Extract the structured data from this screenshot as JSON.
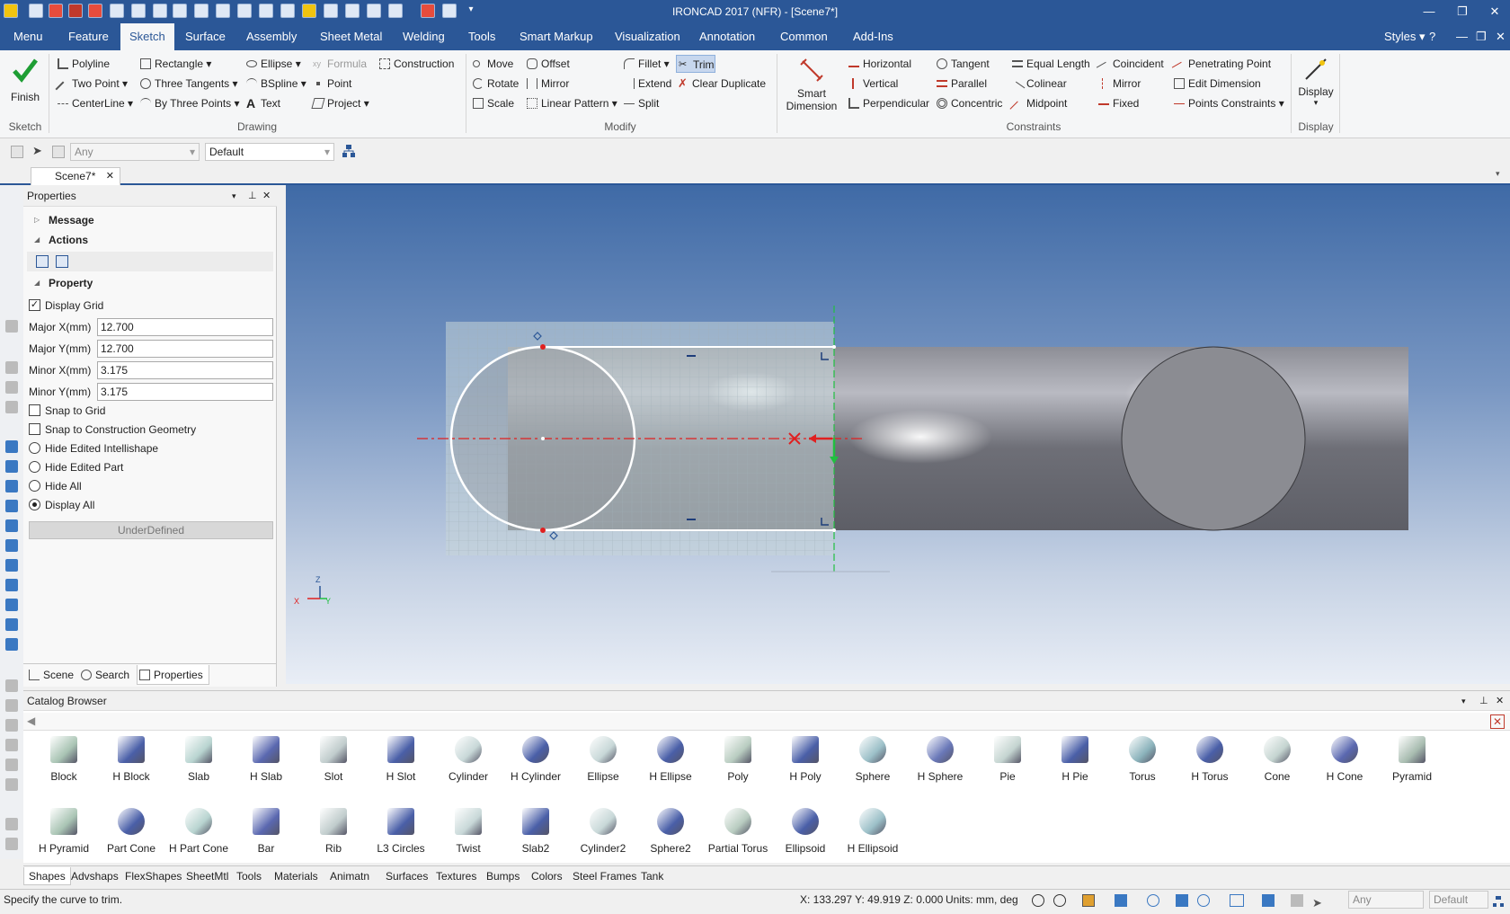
{
  "window": {
    "title": "IRONCAD 2017 (NFR) - [Scene7*]",
    "styles_label": "Styles"
  },
  "menu": [
    "Menu",
    "Feature",
    "Sketch",
    "Surface",
    "Assembly",
    "Sheet Metal",
    "Welding",
    "Tools",
    "Smart Markup",
    "Visualization",
    "Annotation",
    "Common",
    "Add-Ins"
  ],
  "ribbon": {
    "finish": "Finish",
    "groups": {
      "sketch": "Sketch",
      "drawing": "Drawing",
      "modify": "Modify",
      "constraints": "Constraints",
      "display": "Display"
    },
    "drawing": {
      "polyline": "Polyline",
      "rectangle": "Rectangle",
      "ellipse": "Ellipse",
      "formula": "Formula",
      "construction": "Construction",
      "two_point": "Two Point",
      "three_tangents": "Three Tangents",
      "bspline": "BSpline",
      "point": "Point",
      "centerline": "CenterLine",
      "by_three_points": "By Three Points",
      "text": "Text",
      "project": "Project"
    },
    "modify": {
      "move": "Move",
      "offset": "Offset",
      "fillet": "Fillet",
      "trim": "Trim",
      "rotate": "Rotate",
      "mirror": "Mirror",
      "extend": "Extend",
      "clear_duplicate": "Clear Duplicate",
      "scale": "Scale",
      "linear_pattern": "Linear Pattern",
      "split": "Split"
    },
    "smart_dimension_1": "Smart",
    "smart_dimension_2": "Dimension",
    "constraints": {
      "horizontal": "Horizontal",
      "tangent": "Tangent",
      "equal_length": "Equal Length",
      "coincident": "Coincident",
      "penetrating_point": "Penetrating Point",
      "vertical": "Vertical",
      "parallel": "Parallel",
      "colinear": "Colinear",
      "mirror": "Mirror",
      "edit_dimension": "Edit Dimension",
      "perpendicular": "Perpendicular",
      "concentric": "Concentric",
      "midpoint": "Midpoint",
      "fixed": "Fixed",
      "points_constraints": "Points Constraints"
    },
    "display": "Display"
  },
  "filterbar": {
    "filter_value": "Any",
    "style_value": "Default"
  },
  "doc_tab": "Scene7*",
  "properties": {
    "title": "Properties",
    "message": "Message",
    "actions": "Actions",
    "property": "Property",
    "display_grid": "Display Grid",
    "major_x_label": "Major X(mm)",
    "major_x": "12.700",
    "major_y_label": "Major Y(mm)",
    "major_y": "12.700",
    "minor_x_label": "Minor X(mm)",
    "minor_x": "3.175",
    "minor_y_label": "Minor Y(mm)",
    "minor_y": "3.175",
    "snap_grid": "Snap to Grid",
    "snap_construction": "Snap to Construction Geometry",
    "hide_intellishape": "Hide Edited Intellishape",
    "hide_part": "Hide Edited Part",
    "hide_all": "Hide All",
    "display_all": "Display All",
    "state": "UnderDefined",
    "tabs": [
      "Scene",
      "Search",
      "Properties"
    ]
  },
  "catalog": {
    "title": "Catalog Browser",
    "shapes": [
      "Block",
      "H Block",
      "Slab",
      "H Slab",
      "Slot",
      "H Slot",
      "Cylinder",
      "H Cylinder",
      "Ellipse",
      "H Ellipse",
      "Poly",
      "H Poly",
      "Sphere",
      "H Sphere",
      "Pie",
      "H Pie",
      "Torus",
      "H Torus",
      "Cone",
      "H Cone",
      "Pyramid",
      "H Pyramid",
      "Part Cone",
      "H Part Cone",
      "Bar",
      "Rib",
      "L3 Circles",
      "Twist",
      "Slab2",
      "Cylinder2",
      "Sphere2",
      "Partial Torus",
      "Ellipsoid",
      "H Ellipsoid"
    ],
    "tabs": [
      "Shapes",
      "Advshaps",
      "FlexShapes",
      "SheetMtl",
      "Tools",
      "Materials",
      "Animatn",
      "Surfaces",
      "Textures",
      "Bumps",
      "Colors",
      "Steel Frames",
      "Tank"
    ]
  },
  "axes": {
    "z": "Z",
    "x": "X",
    "y": "Y"
  },
  "status": {
    "message": "Specify the curve to trim.",
    "coords": "X: 133.297 Y: 49.919 Z: 0.000",
    "units": "Units: mm, deg",
    "filter": "Any",
    "style": "Default"
  }
}
